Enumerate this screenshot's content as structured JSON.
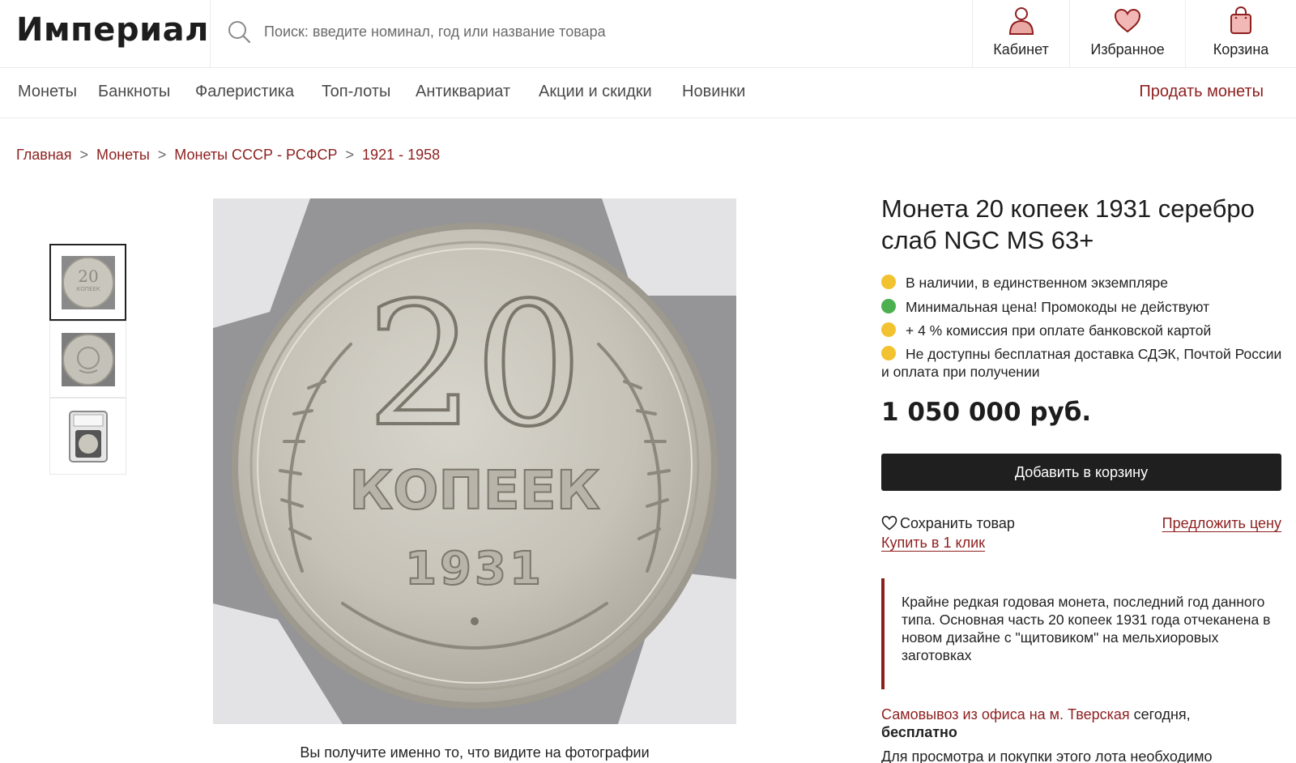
{
  "header": {
    "logo": "Империал",
    "search_placeholder": "Поиск: введите номинал, год или название товара",
    "cabinet_label": "Кабинет",
    "favorites_label": "Избранное",
    "cart_label": "Корзина"
  },
  "nav": {
    "items": [
      "Монеты",
      "Банкноты",
      "Фалеристика",
      "Топ-лоты",
      "Антиквариат",
      "Акции и скидки",
      "Новинки"
    ],
    "sell": "Продать монеты"
  },
  "breadcrumbs": [
    {
      "label": "Главная",
      "sep": ">"
    },
    {
      "label": "Монеты",
      "sep": ">"
    },
    {
      "label": "Монеты СССР - РСФСР",
      "sep": ">"
    },
    {
      "label": "1921 - 1958",
      "sep": ""
    }
  ],
  "gallery": {
    "thumbnails": [
      "coin-reverse",
      "coin-obverse",
      "coin-slab"
    ],
    "active_index": 0,
    "photo": {
      "denomination": "20",
      "word": "КОПЕЕК",
      "year": "1931"
    },
    "caption": "Вы получите именно то, что видите на фотографии"
  },
  "product": {
    "title": "Монета 20 копеек 1931 серебро слаб NGC MS 63+",
    "features": [
      {
        "text": "В наличии, в единственном экземпляре",
        "color": "#f2c230"
      },
      {
        "text": "Минимальная цена! Промокоды не действуют",
        "color": "#4cb050"
      },
      {
        "text": "+ 4 % комиссия при оплате банковской картой",
        "color": "#f2c230"
      },
      {
        "text": "Не доступны бесплатная доставка СДЭК, Почтой России и оплата при получении",
        "color": "#f2c230"
      }
    ],
    "price": "1 050 000 руб.",
    "add_to_cart": "Добавить в корзину",
    "save": "Сохранить товар",
    "offer_price": "Предложить цену",
    "buy_one_click": "Купить в 1 клик",
    "description": "Крайне редкая годовая монета, последний год данного типа. Основная часть 20 копеек 1931 года отчеканена в новом дизайне с \"щитовиком\" на мельхиоровых заготовках",
    "pickup_link": "Самовывоз из офиса на м. Тверская",
    "pickup_when": " сегодня,",
    "pickup_cost": "бесплатно",
    "bottom_text": "Для просмотра и покупки этого лота необходимо"
  },
  "colors": {
    "accent": "#8e1f1f",
    "button": "#1f1f1f"
  }
}
